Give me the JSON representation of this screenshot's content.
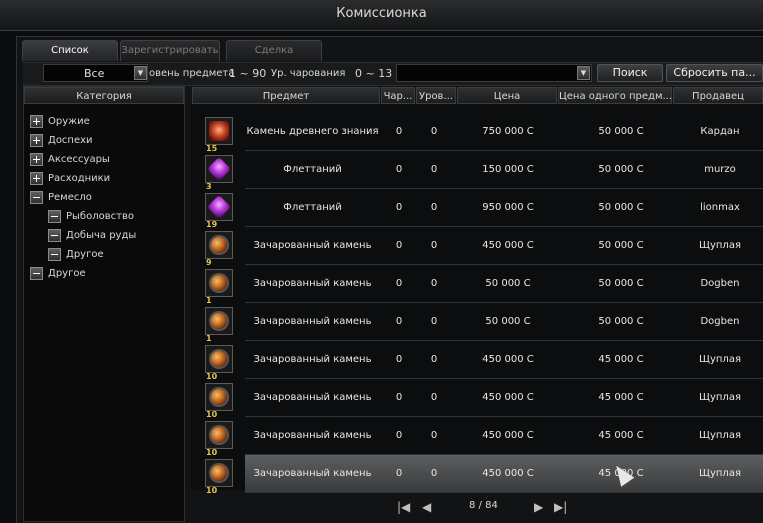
{
  "window": {
    "title": "Комиссионка"
  },
  "tabs": [
    {
      "label": "Список",
      "active": true
    },
    {
      "label": "Зарегистрировать",
      "active": false
    },
    {
      "label": "Сделка",
      "active": false
    }
  ],
  "filters": {
    "grade_select": "Все",
    "level_label": "овень предмета",
    "level_range": "1 ~ 90",
    "enchant_label": "Ур. чарования",
    "enchant_range": "0 ~ 13",
    "search_value": "",
    "search_button": "Поиск",
    "reset_button": "Сбросить па..."
  },
  "category_panel": {
    "header": "Категория",
    "items": [
      {
        "label": "Оружие",
        "state": "collapsed",
        "indent": 0
      },
      {
        "label": "Доспехи",
        "state": "collapsed",
        "indent": 0
      },
      {
        "label": "Аксессуары",
        "state": "collapsed",
        "indent": 0
      },
      {
        "label": "Расходники",
        "state": "collapsed",
        "indent": 0
      },
      {
        "label": "Ремесло",
        "state": "expanded",
        "indent": 0
      },
      {
        "label": "Рыболовство",
        "state": "leaf",
        "indent": 1
      },
      {
        "label": "Добыча руды",
        "state": "leaf",
        "indent": 1
      },
      {
        "label": "Другое",
        "state": "leaf",
        "indent": 1
      },
      {
        "label": "Другое",
        "state": "leaf",
        "indent": 0
      }
    ]
  },
  "columns": {
    "item": "Предмет",
    "enchant": "Чар...",
    "level": "Уров...",
    "price": "Цена",
    "unit_price": "Цена одного предм...",
    "seller": "Продавец"
  },
  "listings": [
    {
      "icon": "ancient-stone-icon",
      "qty": "15",
      "name": "Камень древнего знания",
      "enchant": "0",
      "level": "0",
      "price": "750 000 С",
      "unit_price": "50 000 С",
      "seller": "Кардан",
      "selected": false
    },
    {
      "icon": "flettanium-icon",
      "qty": "3",
      "name": "Флеттаний",
      "enchant": "0",
      "level": "0",
      "price": "150 000 С",
      "unit_price": "50 000 С",
      "seller": "murzo",
      "selected": false
    },
    {
      "icon": "flettanium-icon",
      "qty": "19",
      "name": "Флеттаний",
      "enchant": "0",
      "level": "0",
      "price": "950 000 С",
      "unit_price": "50 000 С",
      "seller": "lionmax",
      "selected": false
    },
    {
      "icon": "enchant-stone-icon",
      "qty": "9",
      "name": "Зачарованный камень",
      "enchant": "0",
      "level": "0",
      "price": "450 000 С",
      "unit_price": "50 000 С",
      "seller": "Щуплая",
      "selected": false
    },
    {
      "icon": "enchant-stone-icon",
      "qty": "1",
      "name": "Зачарованный камень",
      "enchant": "0",
      "level": "0",
      "price": "50 000 С",
      "unit_price": "50 000 С",
      "seller": "Dogben",
      "selected": false
    },
    {
      "icon": "enchant-stone-icon",
      "qty": "1",
      "name": "Зачарованный камень",
      "enchant": "0",
      "level": "0",
      "price": "50 000 С",
      "unit_price": "50 000 С",
      "seller": "Dogben",
      "selected": false
    },
    {
      "icon": "enchant-stone-icon",
      "qty": "10",
      "name": "Зачарованный камень",
      "enchant": "0",
      "level": "0",
      "price": "450 000 С",
      "unit_price": "45 000 С",
      "seller": "Щуплая",
      "selected": false
    },
    {
      "icon": "enchant-stone-icon",
      "qty": "10",
      "name": "Зачарованный камень",
      "enchant": "0",
      "level": "0",
      "price": "450 000 С",
      "unit_price": "45 000 С",
      "seller": "Щуплая",
      "selected": false
    },
    {
      "icon": "enchant-stone-icon",
      "qty": "10",
      "name": "Зачарованный камень",
      "enchant": "0",
      "level": "0",
      "price": "450 000 С",
      "unit_price": "45 000 С",
      "seller": "Щуплая",
      "selected": false
    },
    {
      "icon": "enchant-stone-icon",
      "qty": "10",
      "name": "Зачарованный камень",
      "enchant": "0",
      "level": "0",
      "price": "450 000 С",
      "unit_price": "45 000 С",
      "seller": "Щуплая",
      "selected": true
    }
  ],
  "pagination": {
    "current": "8",
    "total": "84",
    "label": "8 / 84"
  }
}
